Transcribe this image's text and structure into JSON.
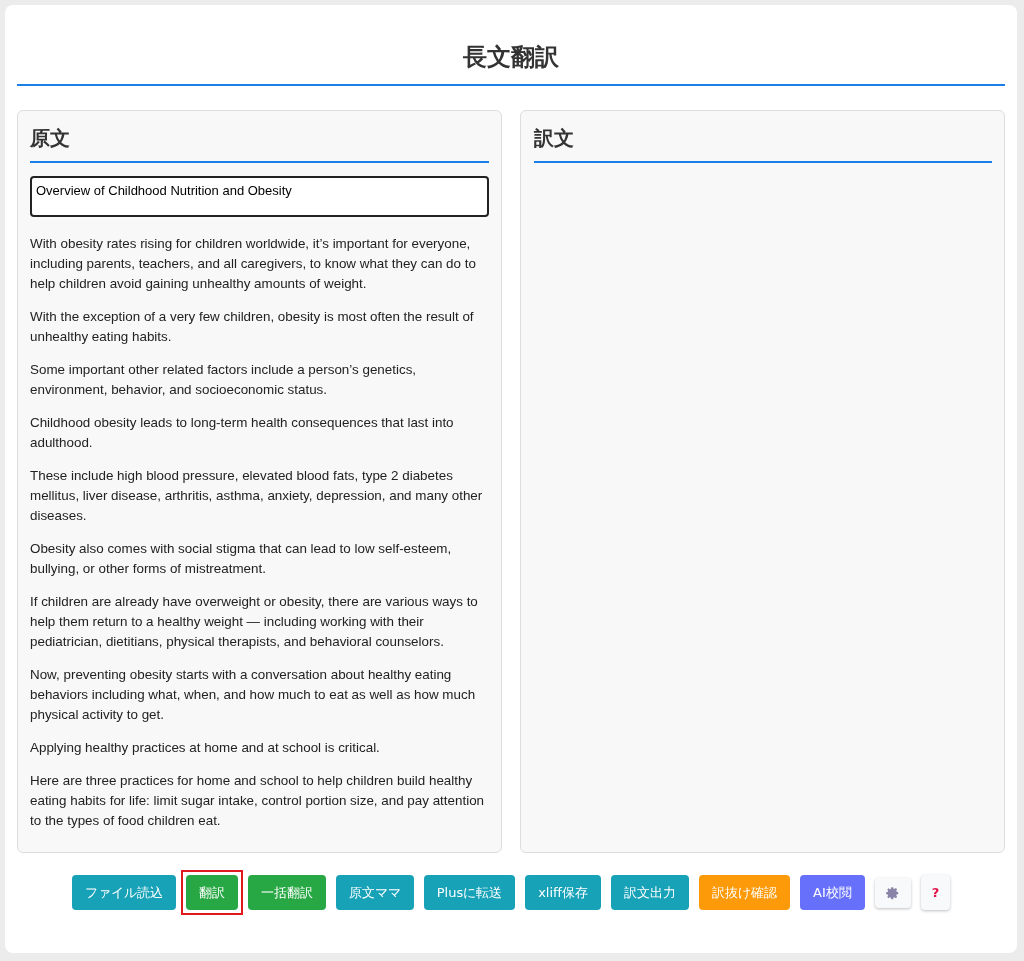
{
  "title": "長文翻訳",
  "source": {
    "heading": "原文",
    "title_field": "Overview of Childhood Nutrition and Obesity",
    "paragraphs": [
      "With obesity rates rising for children worldwide, it’s important for everyone, including parents, teachers, and all caregivers, to know what they can do to help children avoid gaining unhealthy amounts of weight.",
      "With the exception of a very few children, obesity is most often the result of unhealthy eating habits.",
      "Some important other related factors include a person’s genetics, environment, behavior, and socioeconomic status.",
      "Childhood obesity leads to long-term health consequences that last into adulthood.",
      "These include high blood pressure, elevated blood fats, type 2 diabetes mellitus, liver disease, arthritis, asthma, anxiety, depression, and many other diseases.",
      "Obesity also comes with social stigma that can lead to low self-esteem, bullying, or other forms of mistreatment.",
      "If children are already have overweight or obesity, there are various ways to help them return to a healthy weight — including working with their pediatrician, dietitians, physical therapists, and behavioral counselors.",
      "Now, preventing obesity starts with a conversation about healthy eating behaviors including what, when, and how much to eat as well as how much physical activity to get.",
      "Applying healthy practices at home and at school is critical.",
      "Here are three practices for home and school to help children build healthy eating habits for life: limit sugar intake, control portion size, and pay attention to the types of food children eat."
    ]
  },
  "target": {
    "heading": "訳文"
  },
  "buttons": [
    {
      "label": "ファイル読込",
      "kind": "info",
      "highlighted": false
    },
    {
      "label": "翻訳",
      "kind": "success",
      "highlighted": true
    },
    {
      "label": "一括翻訳",
      "kind": "success",
      "highlighted": false
    },
    {
      "label": "原文ママ",
      "kind": "info",
      "highlighted": false
    },
    {
      "label": "Plusに転送",
      "kind": "info",
      "highlighted": false
    },
    {
      "label": "xliff保存",
      "kind": "info",
      "highlighted": false
    },
    {
      "label": "訳文出力",
      "kind": "info",
      "highlighted": false
    },
    {
      "label": "訳抜け確認",
      "kind": "warning",
      "highlighted": false
    },
    {
      "label": "AI校閲",
      "kind": "ai",
      "highlighted": false
    },
    {
      "kind": "settings",
      "highlighted": false
    },
    {
      "kind": "help",
      "label": "?",
      "highlighted": false
    }
  ]
}
